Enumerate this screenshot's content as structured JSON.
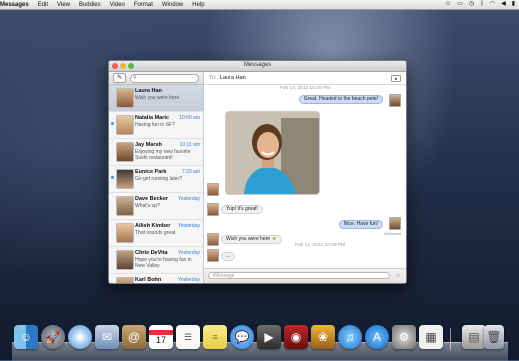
{
  "menubar": {
    "app": "Messages",
    "items": [
      "Edit",
      "View",
      "Buddies",
      "Video",
      "Format",
      "Window",
      "Help"
    ]
  },
  "window": {
    "title": "Messages"
  },
  "sidebar": {
    "search_placeholder": "",
    "conversations": [
      {
        "name": "Laura Han",
        "time": "",
        "snippet": "Wish you were here",
        "selected": true,
        "unread": false
      },
      {
        "name": "Natalia Maric",
        "time": "10:00 am",
        "snippet": "Having fun in SF?",
        "selected": false,
        "unread": true
      },
      {
        "name": "Jay Marsh",
        "time": "10:11 am",
        "snippet": "Enjoying my new favorite Sushi restaurant!",
        "selected": false,
        "unread": false
      },
      {
        "name": "Eunice Park",
        "time": "7:23 am",
        "snippet": "Go get running later?",
        "selected": false,
        "unread": true
      },
      {
        "name": "Dave Becker",
        "time": "Yesterday",
        "snippet": "What's up?",
        "selected": false,
        "unread": false
      },
      {
        "name": "Ailish Kimber",
        "time": "Yesterday",
        "snippet": "That sounds great.",
        "selected": false,
        "unread": false
      },
      {
        "name": "Chris DeVita",
        "time": "Yesterday",
        "snippet": "Hope you're having fun in New Valley",
        "selected": false,
        "unread": false
      },
      {
        "name": "Karl Bohn",
        "time": "Yesterday",
        "snippet": "",
        "selected": false,
        "unread": false
      }
    ]
  },
  "chat": {
    "to_label": "To:",
    "to_name": "Laura Han",
    "stamp1": "Feb 14, 2012 10:00 PM",
    "stamp2": "Feb 14, 2012 10:49 PM",
    "msg1": "Great. Headed to the beach pete!",
    "msg2": "Yup! It's great!",
    "msg3": "Nice. Have fun!",
    "delivered": "Delivered",
    "msg4": "Wish you were here",
    "msg5": "...",
    "input_placeholder": "iMessage"
  },
  "colors": {
    "accent": "#3b7bd3",
    "my_bubble": "#cbdcf6",
    "their_bubble": "#eef0f2"
  },
  "dock": {
    "icons": [
      "finder-icon",
      "launchpad-icon",
      "safari-icon",
      "mail-icon",
      "contacts-icon",
      "calendar-icon",
      "reminders-icon",
      "notes-icon",
      "messages-icon",
      "facetime-icon",
      "photo-booth-icon",
      "iphoto-icon",
      "itunes-icon",
      "app-store-icon",
      "system-preferences-icon",
      "preview-icon",
      "trash-icon"
    ],
    "calendar_day": "17"
  }
}
